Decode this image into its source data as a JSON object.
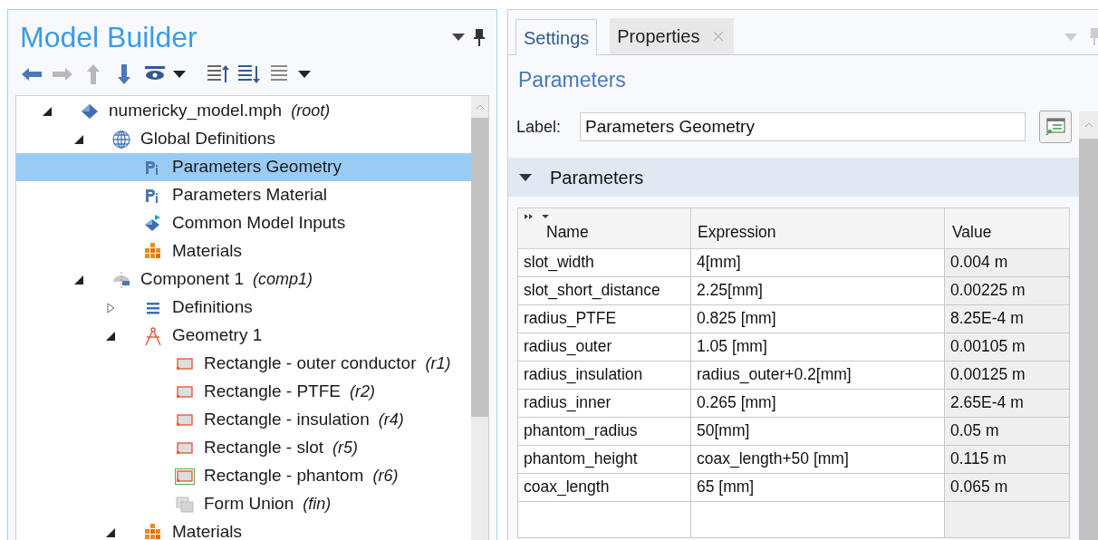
{
  "model_builder": {
    "title": "Model Builder",
    "tree": [
      {
        "kind": "model",
        "label": "numericky_model.mph",
        "tag": "(root)",
        "expanded": true,
        "selected": false,
        "children": [
          {
            "kind": "globe",
            "label": "Global Definitions",
            "expanded": true,
            "selected": false,
            "children": [
              {
                "kind": "param",
                "label": "Parameters Geometry",
                "selected": true
              },
              {
                "kind": "param",
                "label": "Parameters Material",
                "selected": false
              },
              {
                "kind": "inputs",
                "label": "Common Model Inputs",
                "selected": false
              },
              {
                "kind": "materials",
                "label": "Materials",
                "selected": false
              }
            ]
          },
          {
            "kind": "component",
            "label": "Component 1",
            "tag": "(comp1)",
            "expanded": true,
            "selected": false,
            "children": [
              {
                "kind": "list",
                "label": "Definitions",
                "expanded": false,
                "selected": false
              },
              {
                "kind": "geometry",
                "label": "Geometry 1",
                "expanded": true,
                "selected": false,
                "children": [
                  {
                    "kind": "rectangle",
                    "label": "Rectangle - outer conductor",
                    "tag": "(r1)",
                    "selected": false
                  },
                  {
                    "kind": "rectangle",
                    "label": "Rectangle - PTFE",
                    "tag": "(r2)",
                    "selected": false
                  },
                  {
                    "kind": "rectangle",
                    "label": "Rectangle - insulation",
                    "tag": "(r4)",
                    "selected": false
                  },
                  {
                    "kind": "rectangle",
                    "label": "Rectangle - slot",
                    "tag": "(r5)",
                    "selected": false
                  },
                  {
                    "kind": "rectangle-framed",
                    "label": "Rectangle - phantom",
                    "tag": "(r6)",
                    "selected": false
                  },
                  {
                    "kind": "union",
                    "label": "Form Union",
                    "tag": "(fin)",
                    "selected": false
                  }
                ]
              },
              {
                "kind": "materials",
                "label": "Materials",
                "expanded": true,
                "selected": false
              }
            ]
          }
        ]
      }
    ]
  },
  "settings": {
    "tabs": [
      {
        "label": "Settings",
        "selected": true,
        "closable": false
      },
      {
        "label": "Properties",
        "selected": false,
        "closable": true
      }
    ],
    "heading": "Parameters",
    "label_field": {
      "label": "Label:",
      "value": "Parameters Geometry"
    },
    "section": {
      "title": "Parameters",
      "expanded": true
    },
    "table": {
      "columns": [
        "Name",
        "Expression",
        "Value"
      ],
      "rows": [
        [
          "slot_width",
          "4[mm]",
          "0.004 m"
        ],
        [
          "slot_short_distance",
          "2.25[mm]",
          "0.00225 m"
        ],
        [
          "radius_PTFE",
          "0.825 [mm]",
          "8.25E-4 m"
        ],
        [
          "radius_outer",
          "1.05 [mm]",
          "0.00105 m"
        ],
        [
          "radius_insulation",
          "radius_outer+0.2[mm]",
          "0.00125 m"
        ],
        [
          "radius_inner",
          "0.265 [mm]",
          "2.65E-4 m"
        ],
        [
          "phantom_radius",
          "50[mm]",
          "0.05 m"
        ],
        [
          "phantom_height",
          "coax_length+50 [mm]",
          "0.115 m"
        ],
        [
          "coax_length",
          "65 [mm]",
          "0.065 m"
        ]
      ]
    }
  }
}
